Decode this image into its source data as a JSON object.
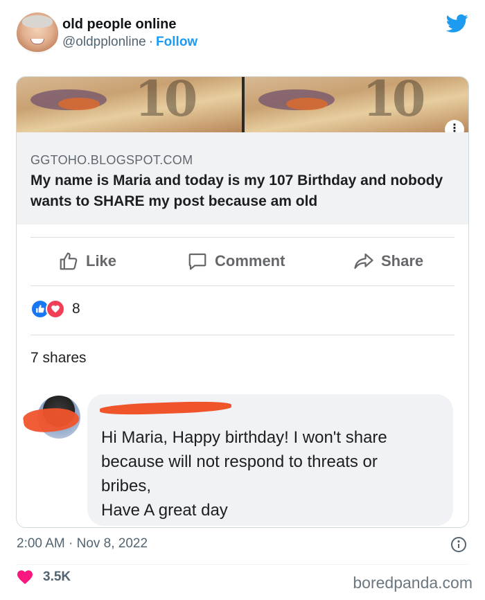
{
  "header": {
    "display_name": "old people online",
    "handle": "@oldpplonline",
    "separator": "·",
    "follow_label": "Follow"
  },
  "card": {
    "domain": "GGTOHO.BLOGSPOT.COM",
    "headline": "My name is Maria and today is my 107 Birthday and nobody wants to SHARE my post because am old",
    "actions": {
      "like_label": "Like",
      "comment_label": "Comment",
      "share_label": "Share"
    },
    "reaction_count": "8",
    "shares_label": "7 shares",
    "comment_text": "Hi Maria, Happy birthday! I won't share\nbecause will not respond to threats or\nbribes,\nHave A great day"
  },
  "footer": {
    "timestamp": "2:00 AM · Nov 8, 2022",
    "likes_count": "3.5K",
    "watermark": "boredpanda.com"
  },
  "colors": {
    "twitter_blue": "#1d9bf0",
    "like_blue": "#1877f2",
    "love_red": "#f33e58",
    "heart_pink": "#f91880",
    "redaction_orange": "#f0542b"
  },
  "icons": [
    "twitter-bird-icon",
    "thumbs-up-icon",
    "comment-icon",
    "share-arrow-icon",
    "like-reaction-icon",
    "love-reaction-icon",
    "info-icon",
    "heart-icon",
    "more-icon"
  ]
}
